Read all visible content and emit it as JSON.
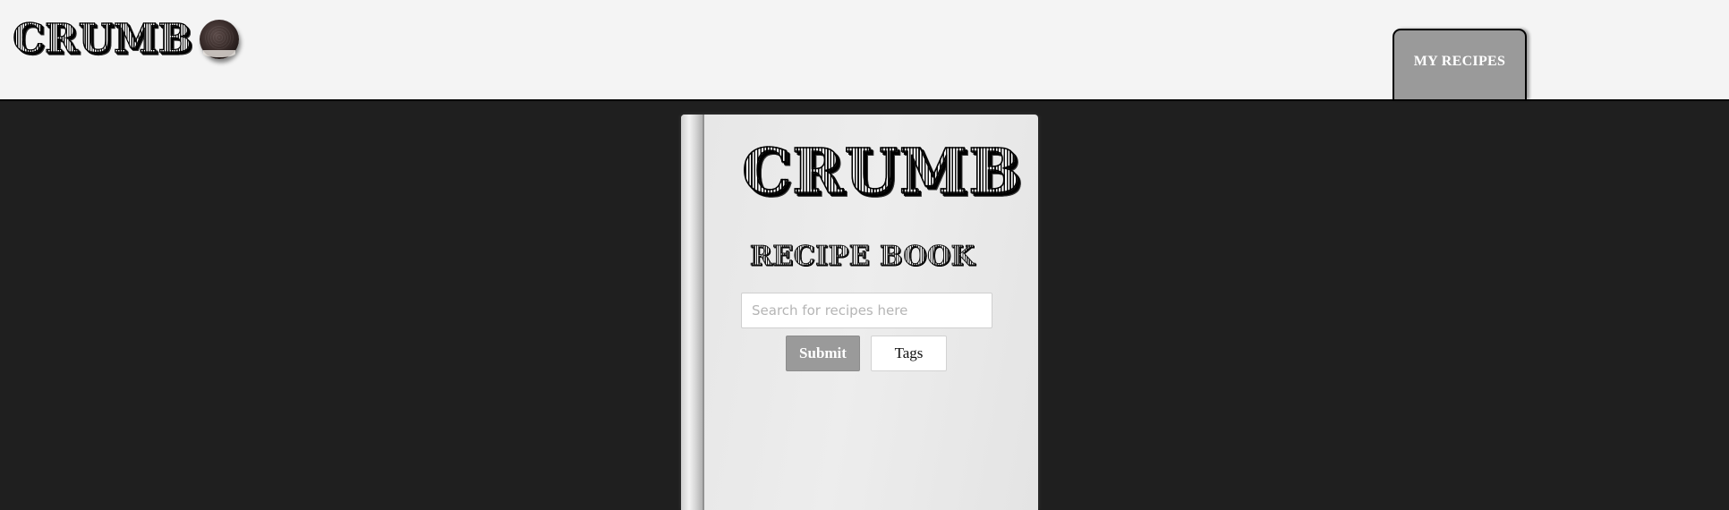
{
  "header": {
    "logo_text": "CRUMB",
    "logo_icon": "cookie-icon",
    "nav": {
      "my_recipes_label": "MY RECIPES"
    }
  },
  "book": {
    "title": "CRUMB",
    "subtitle": "RECIPE BOOK",
    "search": {
      "placeholder": "Search for recipes here",
      "value": ""
    },
    "submit_label": "Submit",
    "tags_label": "Tags"
  },
  "colors": {
    "page_background": "#1f1f1f",
    "header_background": "#f4f4f4",
    "tab_background": "#9a9a9a",
    "submit_background": "#9a9a9a",
    "book_cover": "#e8e8e8"
  }
}
